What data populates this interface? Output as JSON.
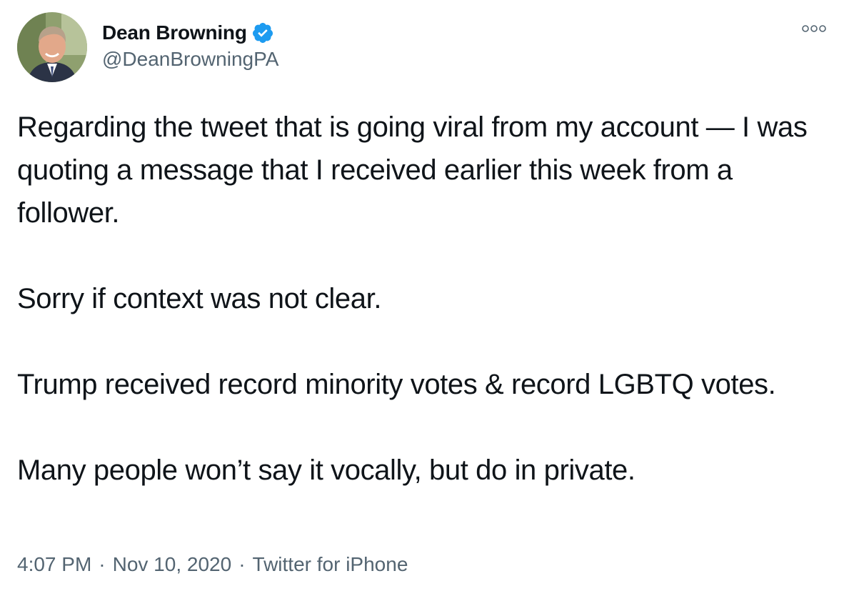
{
  "author": {
    "display_name": "Dean Browning",
    "handle": "@DeanBrowningPA",
    "verified": true
  },
  "icons": {
    "avatar": "profile-photo",
    "verified": "verified-badge-icon",
    "more": "more-options-icon"
  },
  "colors": {
    "verified_blue": "#1d9bf0",
    "secondary_text": "#536471",
    "primary_text": "#0f1419"
  },
  "tweet": {
    "paragraphs": [
      "Regarding the tweet that is going viral from my account — I was quoting a message that I received earlier this week from a follower.",
      "Sorry if context was not clear.",
      "Trump received record minority votes & record LGBTQ votes.",
      "Many people won’t say it vocally, but do in private."
    ],
    "time": "4:07 PM",
    "date": "Nov 10, 2020",
    "source": "Twitter for iPhone",
    "separator": "·"
  }
}
